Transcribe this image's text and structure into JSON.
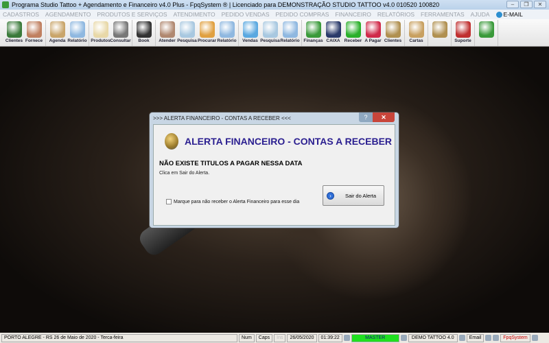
{
  "window": {
    "title": "Programa Studio Tattoo + Agendamento e Financeiro v4.0 Plus - FpqSystem ® | Licenciado para  DEMONSTRAÇÃO STUDIO TATTOO v4.0 010520 100820",
    "buttons": [
      "–",
      "❐",
      "✕"
    ]
  },
  "menu": [
    "CADASTROS",
    "AGENDAMENTO",
    "PRODUTOS E SERVIÇOS",
    "ATENDIMENTO",
    "PEDIDO VENDAS",
    "PEDIDO COMPRAS",
    "FINANCEIRO",
    "RELATÓRIOS",
    "FERRAMENTAS",
    "AJUDA"
  ],
  "menu_email": "E-MAIL",
  "toolbar": [
    [
      {
        "label": "Clientes",
        "color": "#3a7a3a"
      },
      {
        "label": "Fornece",
        "color": "#c08060"
      }
    ],
    [
      {
        "label": "Agenda",
        "color": "#c9a56a"
      },
      {
        "label": "Relatório",
        "color": "#8fb8e0"
      }
    ],
    [
      {
        "label": "Produtos",
        "color": "#e8d8a8"
      },
      {
        "label": "Consultar",
        "color": "#777"
      }
    ],
    [
      {
        "label": "Book",
        "color": "#333"
      }
    ],
    [
      {
        "label": "Atender",
        "color": "#b08870"
      },
      {
        "label": "Pesquisa",
        "color": "#a8c8e0"
      },
      {
        "label": "Procurar",
        "color": "#e0a040"
      },
      {
        "label": "Relatório",
        "color": "#8fb8e0"
      }
    ],
    [
      {
        "label": "Vendas",
        "color": "#5aa8e0"
      },
      {
        "label": "Pesquisa",
        "color": "#a8c8e0"
      },
      {
        "label": "Relatório",
        "color": "#8fb8e0"
      }
    ],
    [
      {
        "label": "Finanças",
        "color": "#3a9a3a"
      },
      {
        "label": "CAIXA",
        "color": "#2a3a6a"
      },
      {
        "label": "Receber",
        "color": "#2ab02a"
      },
      {
        "label": "A Pagar",
        "color": "#d02a4a"
      },
      {
        "label": "Clientes",
        "color": "#b09050"
      }
    ],
    [
      {
        "label": "Cartas",
        "color": "#c8a060"
      }
    ],
    [
      {
        "label": "",
        "color": "#b09050"
      }
    ],
    [
      {
        "label": "Suporte",
        "color": "#c03030"
      }
    ],
    [
      {
        "label": "",
        "color": "#3a9a3a"
      }
    ]
  ],
  "dialog": {
    "title": ">>> ALERTA FINANCEIRO - CONTAS A RECEBER <<<",
    "help": "?",
    "close": "✕",
    "heading": "ALERTA FINANCEIRO - CONTAS A RECEBER",
    "message": "NÃO EXISTE TITULOS A PAGAR NESSA DATA",
    "hint": "Clica em Sair do Alerta.",
    "checkbox_label": "Marque para não receber o Alerta Financeiro para esse dia",
    "checkbox_checked": false,
    "exit_button": "Sair do Alerta"
  },
  "status": {
    "location": "PORTO ALEGRE - RS 26 de Maio de 2020 - Terca-feira",
    "num": "Num",
    "caps": "Caps",
    "ins": "Ins",
    "date": "26/05/2020",
    "time": "01:39:22",
    "user": "MASTER",
    "company": "DEMO TATTOO 4.0",
    "email": "Email",
    "brand": "FpqSystem"
  }
}
